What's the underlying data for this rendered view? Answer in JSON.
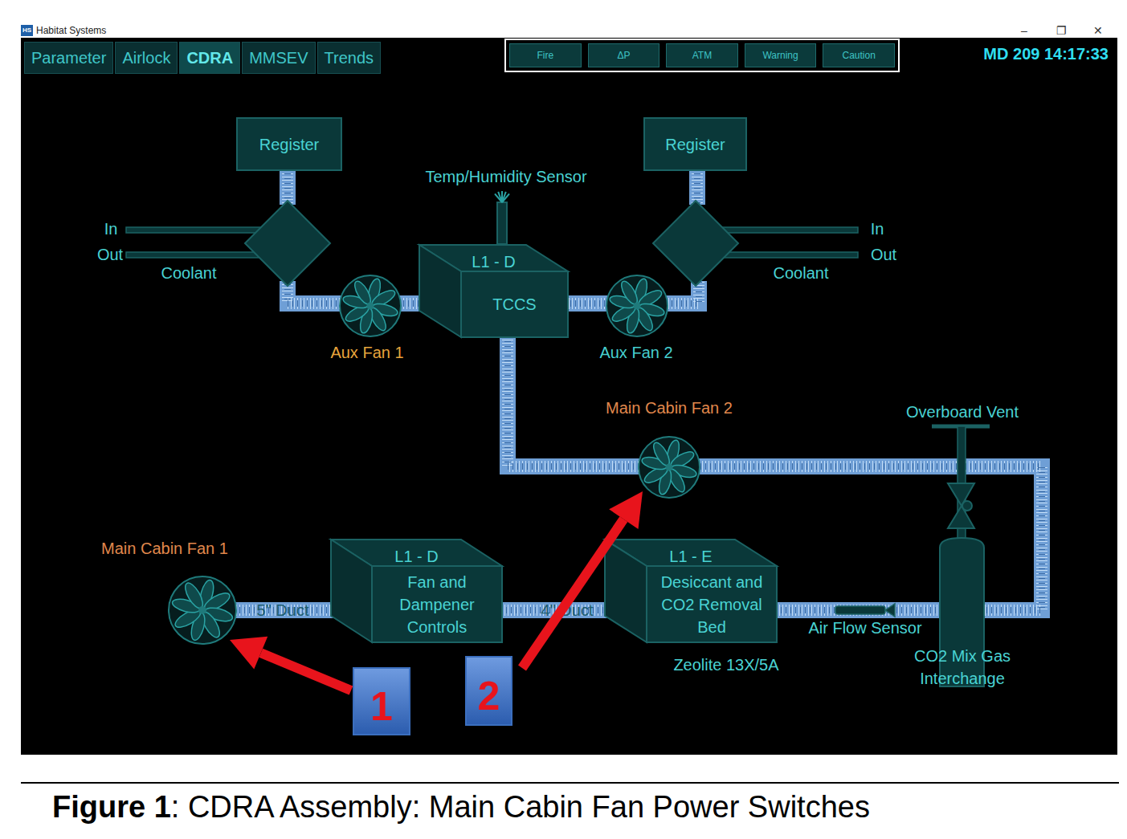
{
  "window": {
    "icon": "HS",
    "title": "Habitat Systems",
    "controls": [
      "–",
      "❐",
      "✕"
    ]
  },
  "tabs": [
    {
      "label": "Parameter",
      "selected": false
    },
    {
      "label": "Airlock",
      "selected": false
    },
    {
      "label": "CDRA",
      "selected": true
    },
    {
      "label": "MMSEV",
      "selected": false
    },
    {
      "label": "Trends",
      "selected": false
    }
  ],
  "alarms": [
    "Fire",
    "ΔP",
    "ATM",
    "Warning",
    "Caution"
  ],
  "clock": "MD 209 14:17:33",
  "diagram": {
    "registers": [
      "Register",
      "Register"
    ],
    "coolant": [
      {
        "in": "In",
        "out": "Out",
        "label": "Coolant"
      },
      {
        "in": "In",
        "out": "Out",
        "label": "Coolant"
      }
    ],
    "sensor": "Temp/Humidity Sensor",
    "fans": [
      {
        "name": "Aux Fan 1",
        "color": "#e8a53c"
      },
      {
        "name": "Aux Fan 2",
        "color": "#46cfcf"
      },
      {
        "name": "Main Cabin Fan 2",
        "color": "#e0884c"
      },
      {
        "name": "Main Cabin Fan 1",
        "color": "#e0884c"
      }
    ],
    "boxes": [
      {
        "code": "L1 - D",
        "lines": [
          "TCCS"
        ]
      },
      {
        "code": "L1 - D",
        "lines": [
          "Fan and",
          "Dampener",
          "Controls"
        ]
      },
      {
        "code": "L1 - E",
        "lines": [
          "Desiccant and",
          "CO2 Removal",
          "Bed"
        ]
      }
    ],
    "ducts": [
      "5\" Duct",
      "4\" Duct"
    ],
    "bed_material": "Zeolite 13X/5A",
    "air_flow_sensor": "Air Flow Sensor",
    "overboard_vent": "Overboard Vent",
    "interchange": [
      "CO2 Mix Gas",
      "Interchange"
    ],
    "callouts": [
      "1",
      "2"
    ]
  },
  "caption": {
    "number": "Figure 1",
    "text": ": CDRA Assembly: Main Cabin Fan Power Switches"
  }
}
